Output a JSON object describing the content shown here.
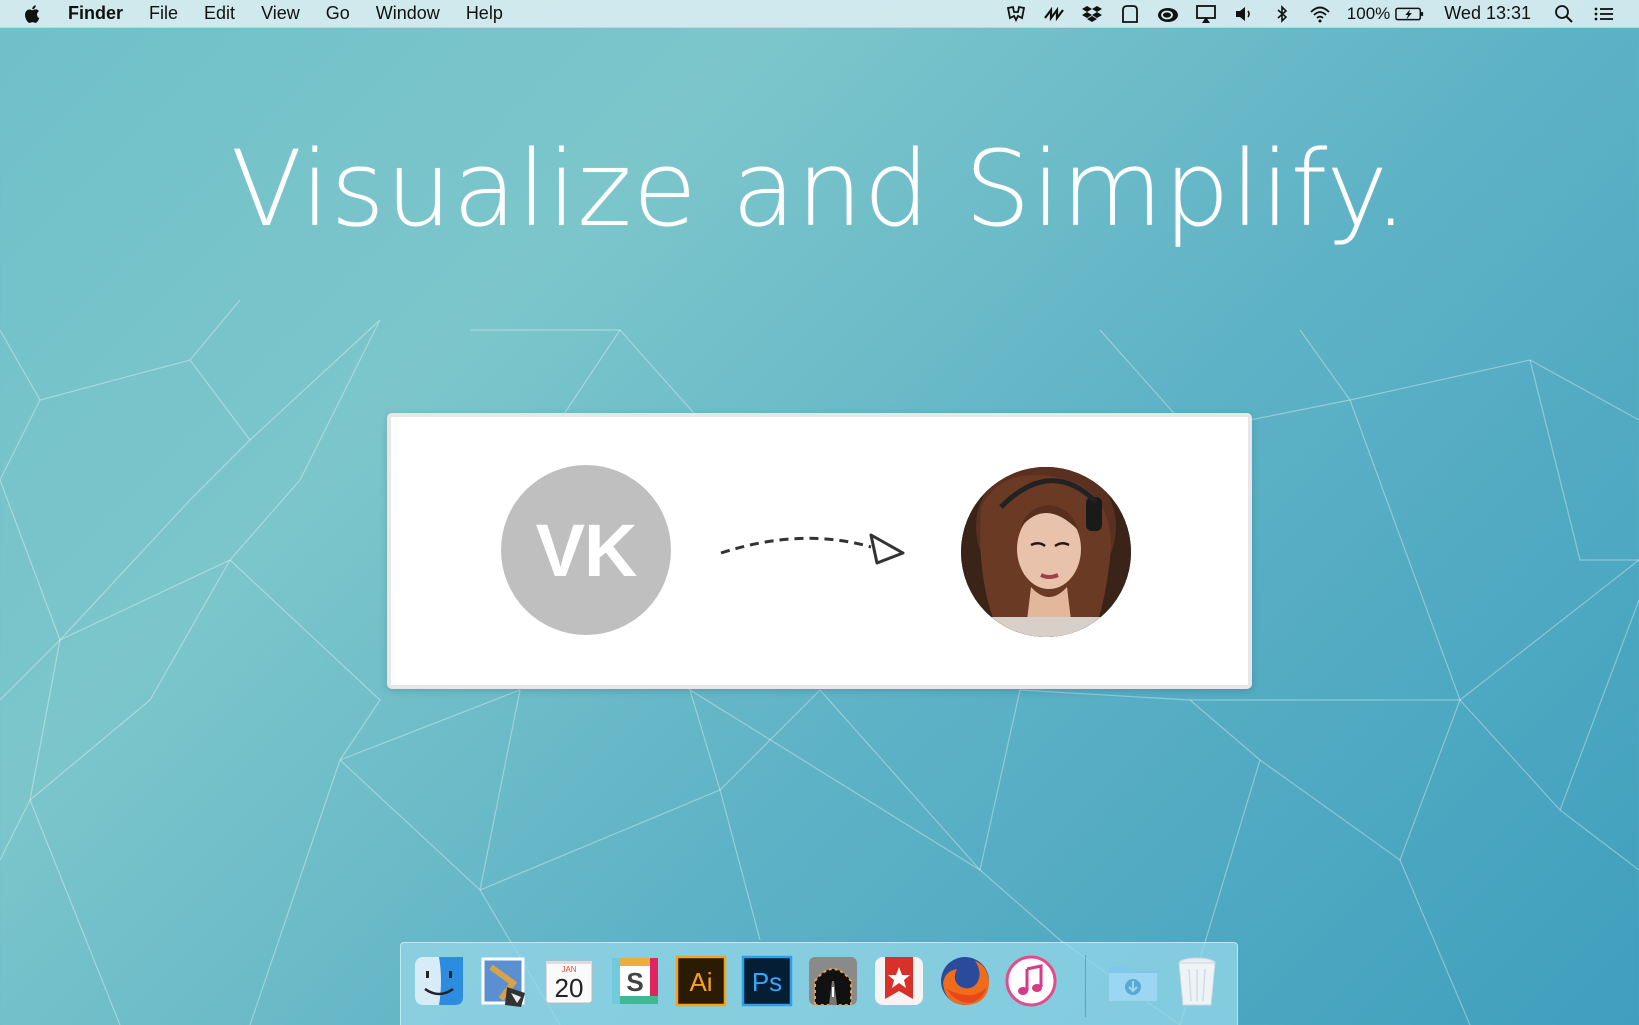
{
  "menubar": {
    "apple_icon": "apple-logo-icon",
    "app_name": "Finder",
    "menus": [
      "File",
      "Edit",
      "View",
      "Go",
      "Window",
      "Help"
    ],
    "status_icons": [
      "evernote-icon",
      "readdle-icon",
      "dropbox-icon",
      "notification-icon",
      "creative-cloud-icon",
      "airplay-icon",
      "volume-icon",
      "bluetooth-icon",
      "wifi-icon"
    ],
    "battery_percent": "100%",
    "battery_icon": "battery-charging-icon",
    "clock": "Wed 13:31",
    "spotlight_icon": "spotlight-search-icon",
    "notification_center_icon": "notification-center-icon"
  },
  "headline": "Visualize and Simplify.",
  "card": {
    "vk_label": "VK",
    "arrow_icon": "dashed-arrow-icon",
    "avatar_icon": "user-photo-avatar"
  },
  "dock": {
    "apps": [
      {
        "name": "finder-icon",
        "running": true
      },
      {
        "name": "mail-icon",
        "running": true
      },
      {
        "name": "calendar-icon",
        "running": false,
        "month": "JAN",
        "day": "20"
      },
      {
        "name": "slack-icon",
        "running": true
      },
      {
        "name": "illustrator-icon",
        "running": true,
        "label": "Ai"
      },
      {
        "name": "photoshop-icon",
        "running": true,
        "label": "Ps"
      },
      {
        "name": "tunnelblick-icon",
        "running": true
      },
      {
        "name": "wunderlist-icon",
        "running": true
      },
      {
        "name": "firefox-icon",
        "running": true
      },
      {
        "name": "itunes-icon",
        "running": true
      }
    ],
    "downloads_icon": "downloads-folder-icon",
    "trash_icon": "trash-icon"
  },
  "colors": {
    "wallpaper": "#6fc0c9",
    "vk_circle": "#bfbfbf",
    "dock": "#96d7e8"
  }
}
